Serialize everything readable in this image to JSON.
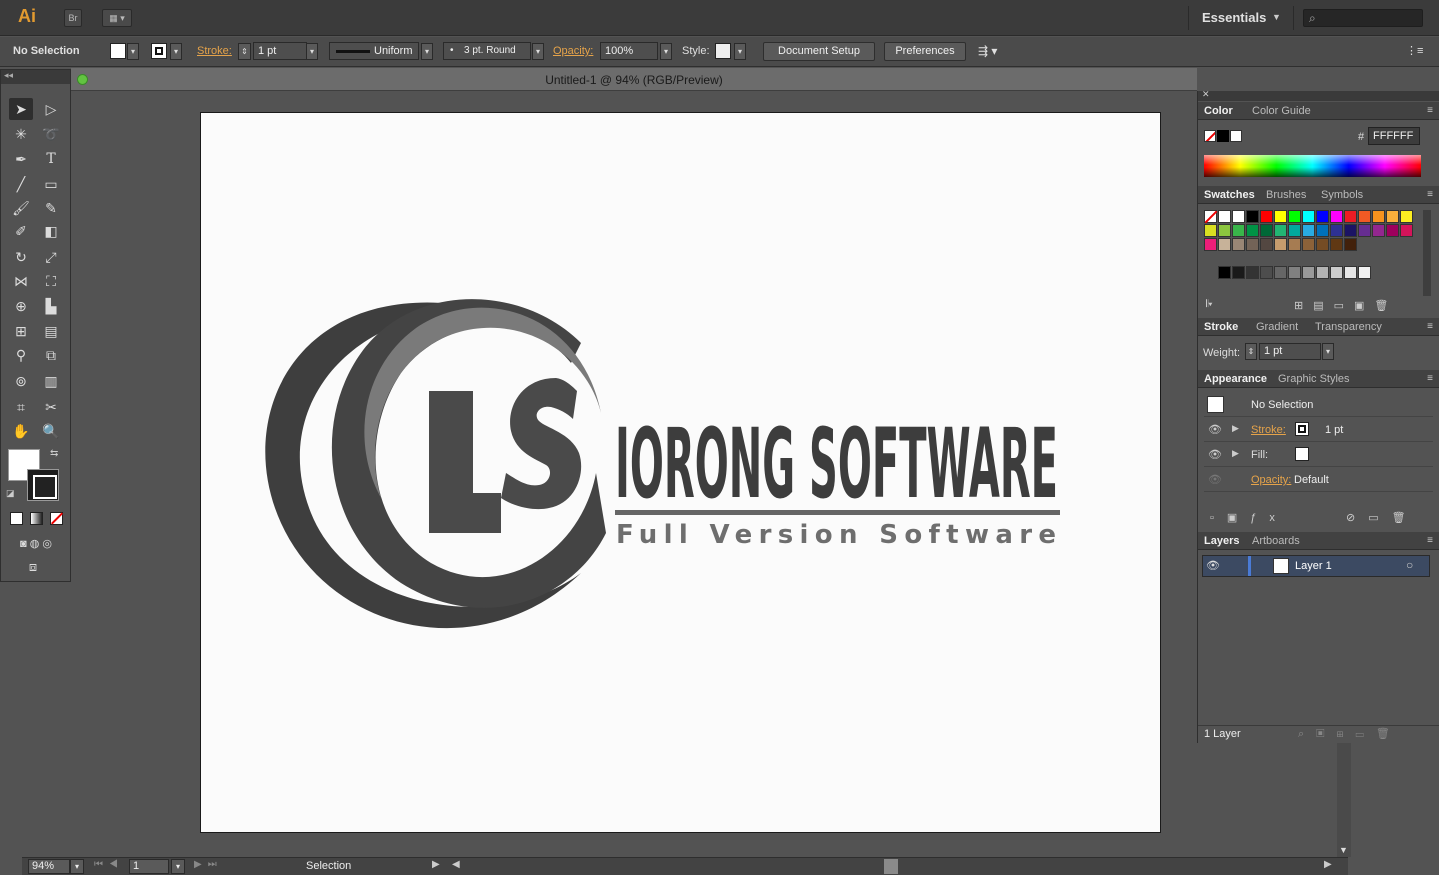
{
  "app": {
    "logo_text": "Ai",
    "bridge_label": "Br",
    "workspace": "Essentials"
  },
  "control_bar": {
    "selection_status": "No Selection",
    "stroke_label": "Stroke:",
    "stroke_weight": "1 pt",
    "stroke_profile": "Uniform",
    "brush_def": "3 pt. Round",
    "opacity_label": "Opacity:",
    "opacity_value": "100%",
    "style_label": "Style:",
    "document_setup_label": "Document Setup",
    "preferences_label": "Preferences"
  },
  "document": {
    "title": "Untitled-1 @ 94% (RGB/Preview)"
  },
  "artwork": {
    "monogram": "LS",
    "brand_name": "IORONG SOFTWARE",
    "tagline": "Full Version Software"
  },
  "panels": {
    "color": {
      "tabs": [
        "Color",
        "Color Guide"
      ],
      "hash_label": "#",
      "hex_value": "FFFFFF"
    },
    "swatches": {
      "tabs": [
        "Swatches",
        "Brushes",
        "Symbols"
      ],
      "colors": [
        "#000000",
        "#ff0000",
        "#ffff00",
        "#00ff00",
        "#00ffff",
        "#0000ff",
        "#ff00ff",
        "#ed1c24",
        "#f15a24",
        "#f7931e",
        "#fbb03b",
        "#fcee21",
        "#d9e021",
        "#8cc63f",
        "#39b54a",
        "#009245",
        "#006837",
        "#22b573",
        "#00a99d",
        "#29abe2",
        "#0071bc",
        "#2e3192",
        "#1b1464",
        "#662d91",
        "#93278f",
        "#9e005d",
        "#d4145a",
        "#ed1e79",
        "#c7b299",
        "#998675",
        "#736357",
        "#534741",
        "#c69c6d",
        "#a67c52",
        "#8c6239",
        "#754c24",
        "#603813",
        "#42210b"
      ],
      "grays": [
        "#000000",
        "#1a1a1a",
        "#333333",
        "#4d4d4d",
        "#666666",
        "#808080",
        "#999999",
        "#b3b3b3",
        "#cccccc",
        "#e6e6e6",
        "#f2f2f2"
      ]
    },
    "stroke": {
      "tabs": [
        "Stroke",
        "Gradient",
        "Transparency"
      ],
      "weight_label": "Weight:",
      "weight_value": "1 pt"
    },
    "appearance": {
      "tabs": [
        "Appearance",
        "Graphic Styles"
      ],
      "header": "No Selection",
      "stroke_label": "Stroke:",
      "stroke_value": "1 pt",
      "fill_label": "Fill:",
      "opacity_label": "Opacity:",
      "opacity_value": "Default"
    },
    "layers": {
      "tabs": [
        "Layers",
        "Artboards"
      ],
      "items": [
        {
          "name": "Layer 1"
        }
      ],
      "count_label": "1 Layer"
    }
  },
  "status_bar": {
    "zoom": "94%",
    "artboard_number": "1",
    "tool_name": "Selection"
  }
}
